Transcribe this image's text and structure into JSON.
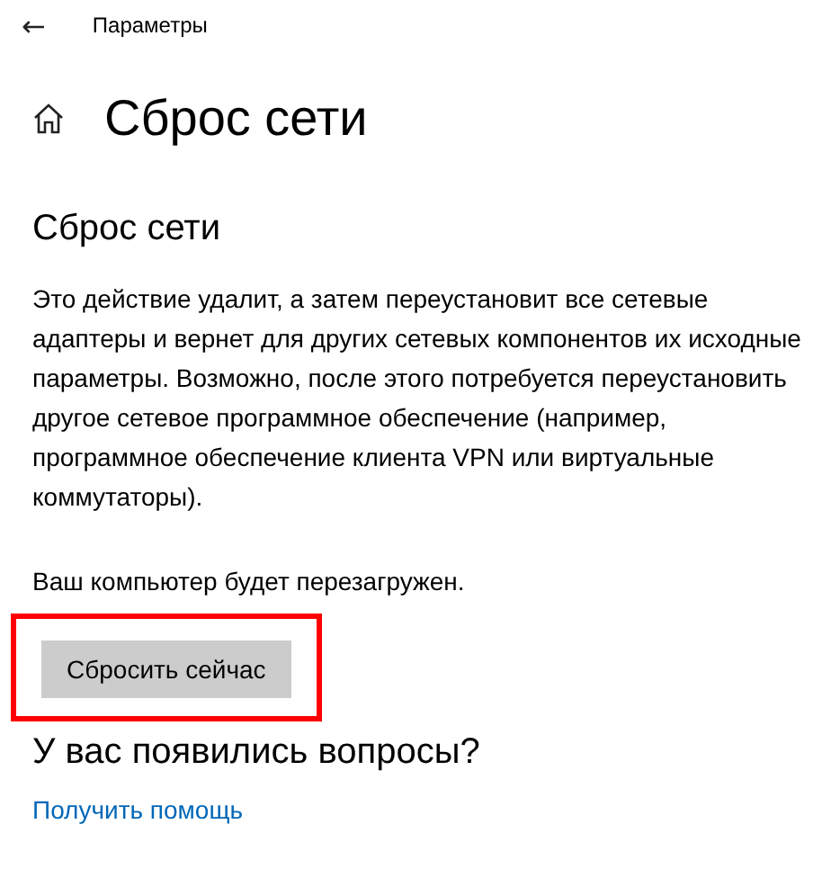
{
  "window": {
    "title": "Параметры",
    "back": "←"
  },
  "page": {
    "title": "Сброс сети"
  },
  "section": {
    "heading": "Сброс сети",
    "description": "Это действие удалит, а затем переустановит все сетевые адаптеры и вернет для других сетевых компонентов их исходные параметры. Возможно, после этого потребуется переустановить другое сетевое программное обеспечение (например, программное обеспечение клиента VPN или виртуальные коммутаторы).",
    "notice": "Ваш компьютер будет перезагружен.",
    "button": {
      "label": "Сбросить сейчас",
      "highlighted": true
    }
  },
  "help": {
    "heading": "У вас появились вопросы?",
    "link": "Получить помощь"
  }
}
